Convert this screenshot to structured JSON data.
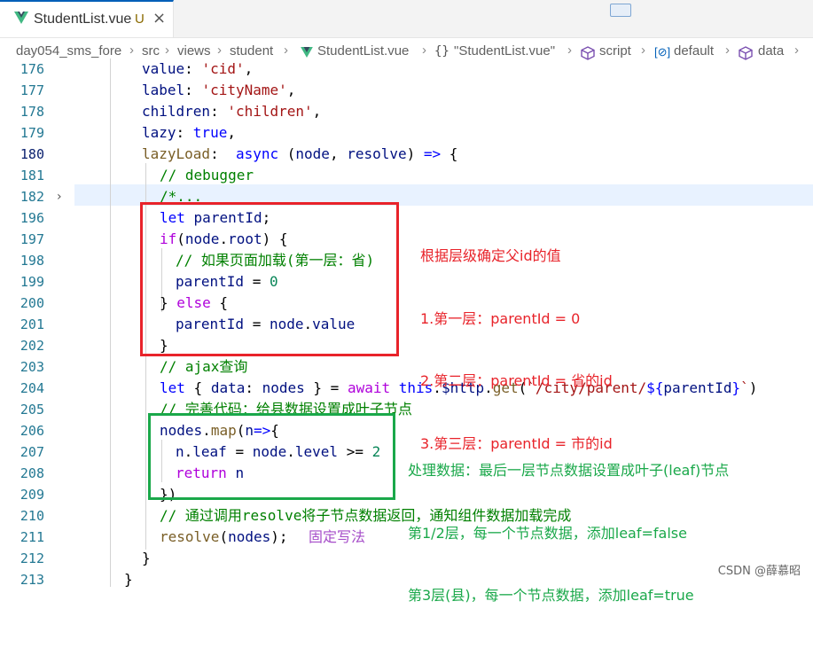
{
  "tab": {
    "title": "StudentList.vue",
    "status": "U",
    "close": "×",
    "vue_icon": "vue-logo-icon"
  },
  "breadcrumb": {
    "items": [
      "day054_sms_fore",
      "src",
      "views",
      "student",
      "StudentList.vue",
      "\"StudentList.vue\"",
      "script",
      "default",
      "data"
    ],
    "separator": "›"
  },
  "colors": {
    "keyword": "#0000ff",
    "control": "#af00db",
    "string": "#a31515",
    "property": "#001080",
    "comment": "#008000",
    "line_number": "#237893",
    "red_box": "#e8232a",
    "green_box": "#1aa84a"
  },
  "editor": {
    "lines": [
      {
        "num": "176",
        "code": "value: 'cid',"
      },
      {
        "num": "177",
        "code": "label: 'cityName',"
      },
      {
        "num": "178",
        "code": "children: 'children',"
      },
      {
        "num": "179",
        "code": "lazy: true,"
      },
      {
        "num": "180",
        "code": "lazyLoad:  async (node, resolve) => {"
      },
      {
        "num": "181",
        "code": "// debugger"
      },
      {
        "num": "182",
        "code": "/*..."
      },
      {
        "num": "196",
        "code": "let parentId;"
      },
      {
        "num": "197",
        "code": "if(node.root) {"
      },
      {
        "num": "198",
        "code": "// 如果页面加载(第一层：省)"
      },
      {
        "num": "199",
        "code": "parentId = 0"
      },
      {
        "num": "200",
        "code": "} else {"
      },
      {
        "num": "201",
        "code": "parentId = node.value"
      },
      {
        "num": "202",
        "code": "}"
      },
      {
        "num": "203",
        "code": "// ajax查询"
      },
      {
        "num": "204",
        "code": "let { data: nodes } = await this.$http.get(`/city/parent/${parentId}`)"
      },
      {
        "num": "205",
        "code": "// 完善代码：给县数据设置成叶子节点"
      },
      {
        "num": "206",
        "code": "nodes.map(n=>{"
      },
      {
        "num": "207",
        "code": "n.leaf = node.level >= 2"
      },
      {
        "num": "208",
        "code": "return n"
      },
      {
        "num": "209",
        "code": "})"
      },
      {
        "num": "210",
        "code": "// 通过调用resolve将子节点数据返回，通知组件数据加载完成"
      },
      {
        "num": "211",
        "code": "resolve(nodes);"
      },
      {
        "num": "212",
        "code": "}"
      },
      {
        "num": "213",
        "code": "}"
      }
    ]
  },
  "annotations": {
    "red": [
      "根据层级确定父id的值",
      "1.第一层：parentId = 0",
      "2.第二层：parentId = 省的id",
      "3.第三层：parentId = 市的id"
    ],
    "green": [
      "处理数据：最后一层节点数据设置成叶子(leaf)节点",
      "第1/2层，每一个节点数据，添加leaf=false",
      "第3层(县)，每一个节点数据，添加leaf=true"
    ],
    "purple": "固定写法"
  },
  "watermark": "CSDN @薛慕昭"
}
